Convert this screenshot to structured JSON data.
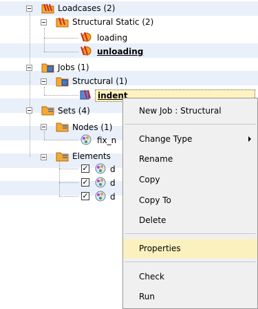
{
  "tree": {
    "loadcases": {
      "label": "Loadcases (2)"
    },
    "structural_static": {
      "label": "Structural Static (2)"
    },
    "loading": {
      "label": "loading"
    },
    "unloading": {
      "label": "unloading"
    },
    "jobs": {
      "label": "Jobs (1)"
    },
    "jobs_structural": {
      "label": "Structural (1)"
    },
    "indent": {
      "label": "indent"
    },
    "sets": {
      "label": "Sets (4)"
    },
    "nodes": {
      "label": "Nodes (1)"
    },
    "fix_nodes": {
      "label": "fix_n"
    },
    "elements": {
      "label": "Elements"
    },
    "element_items": [
      {
        "label": "d",
        "checked": true
      },
      {
        "label": "d",
        "checked": true
      },
      {
        "label": "d",
        "checked": true
      }
    ]
  },
  "context_menu": {
    "new_job": "New Job : Structural",
    "change_type": "Change Type",
    "rename": "Rename",
    "copy": "Copy",
    "copy_to": "Copy To",
    "delete": "Delete",
    "properties": "Properties",
    "check": "Check",
    "run": "Run"
  },
  "colors": {
    "row_alt": "#e9f0fa",
    "highlight": "#fbf1be",
    "menu_bg": "#f0f0f0"
  }
}
